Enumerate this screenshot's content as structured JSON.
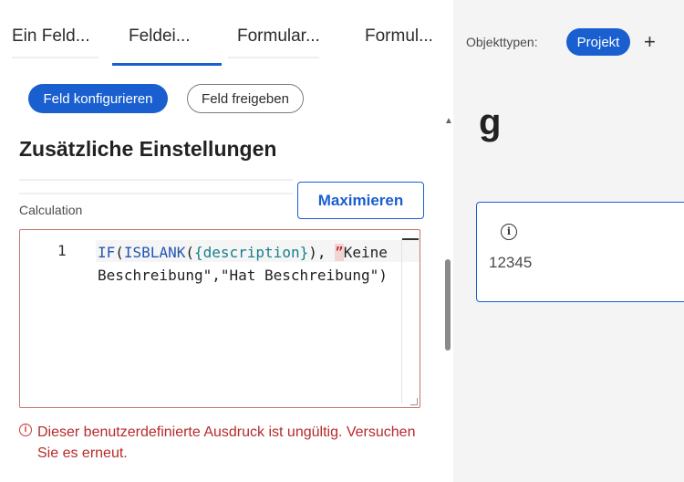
{
  "tabs": [
    {
      "label": "Ein Feld..."
    },
    {
      "label": "Feldei..."
    },
    {
      "label": "Formular..."
    },
    {
      "label": "Formul..."
    }
  ],
  "actions": {
    "configure_label": "Feld konfigurieren",
    "share_label": "Feld freigeben"
  },
  "section": {
    "title": "Zusätzliche Einstellungen",
    "maximize_label": "Maximieren",
    "calculation_label": "Calculation"
  },
  "editor": {
    "line_number": "1",
    "code_func1": "IF",
    "code_paren1": "(",
    "code_func2": "ISBLANK",
    "code_paren2": "(",
    "code_field": "{description}",
    "code_rest1": "), ",
    "code_bad_quote": "”",
    "code_rest2": "Keine Beschreibung\",\"Hat Beschreibung\")"
  },
  "error": {
    "icon": "info-circle-icon",
    "message": "Dieser benutzerdefinierte Ausdruck ist ungültig. Versuchen Sie es erneut."
  },
  "right_panel": {
    "object_types_label": "Objekttypen:",
    "object_type_pill": "Projekt",
    "add_symbol": "+",
    "preview_heading": "g",
    "card_value": "12345"
  },
  "colors": {
    "accent": "#1a5fd0",
    "error": "#b82a2a",
    "panel_bg": "#f4f4f4"
  }
}
